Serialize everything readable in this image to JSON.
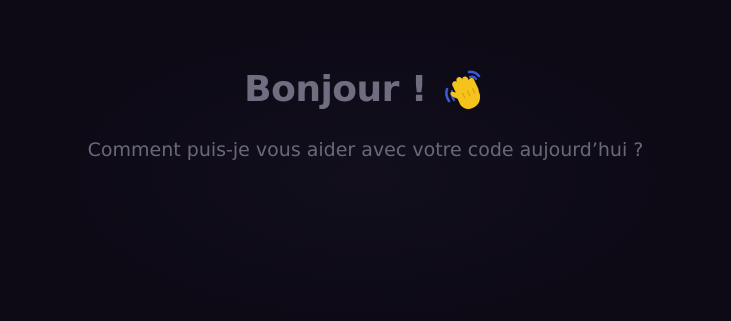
{
  "welcome": {
    "greeting": "Bonjour !",
    "greeting_icon": "waving-hand-icon",
    "subtitle": "Comment puis-je vous aider avec votre code aujourd’hui ?"
  },
  "colors": {
    "background": "#0d0a16",
    "greeting_text": "#6f6d7f",
    "subtitle_text": "#6a6878",
    "wave_hand": "#f6c21c"
  }
}
